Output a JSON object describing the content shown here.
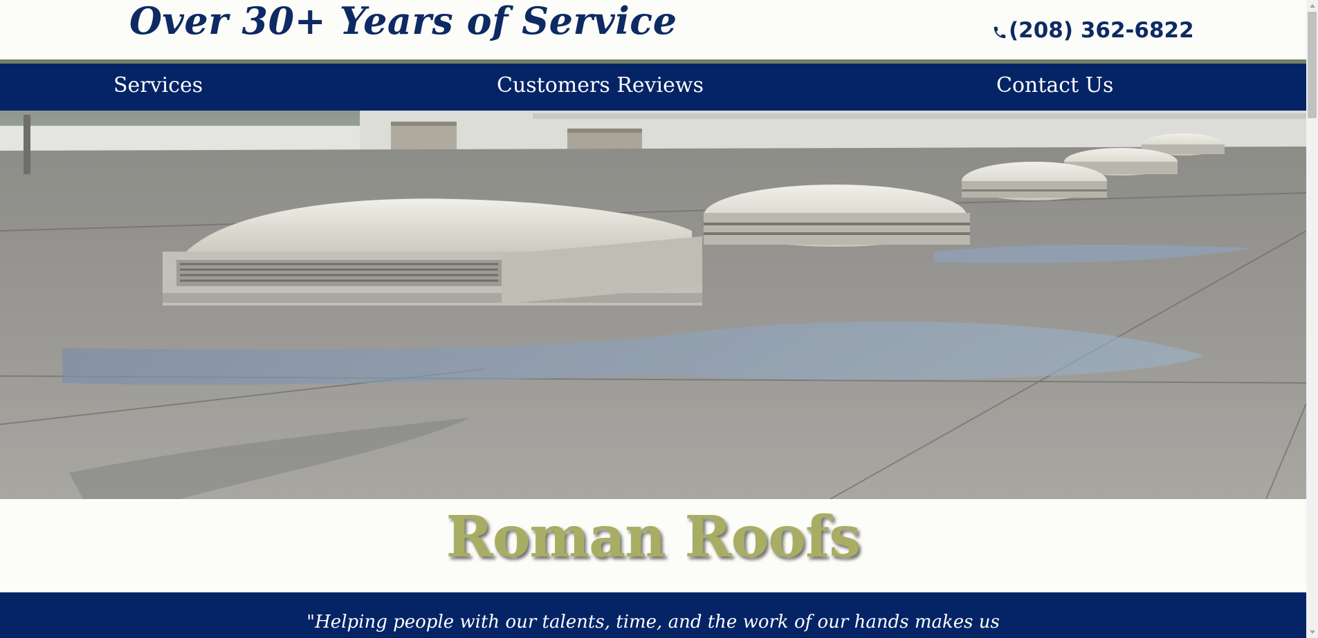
{
  "header": {
    "tagline": "Over 30+ Years of Service",
    "phone": "(208) 362-6822",
    "phone_icon": "phone-icon"
  },
  "nav": {
    "items": [
      {
        "label": "Services"
      },
      {
        "label": "Customers Reviews"
      },
      {
        "label": "Contact Us"
      }
    ]
  },
  "brand": {
    "name": "Roman Roofs"
  },
  "quote": {
    "text": "\"Helping people with our talents, time, and the work of our hands makes us"
  },
  "colors": {
    "navy": "#042466",
    "brand_olive": "#a8ad63",
    "background": "#fcfcf9"
  }
}
